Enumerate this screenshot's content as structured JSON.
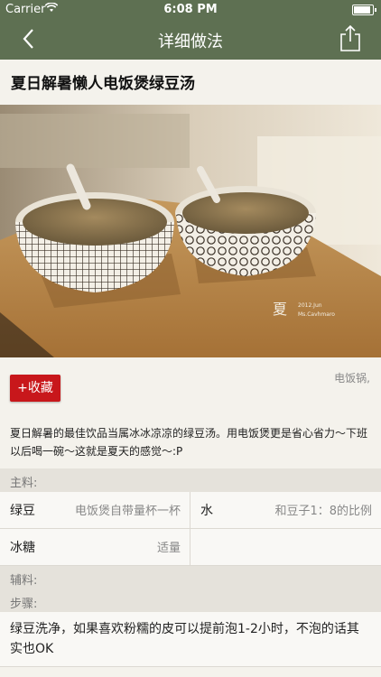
{
  "status_bar": {
    "carrier": "Carrier",
    "time": "6:08 PM",
    "battery_level": 0.9
  },
  "nav": {
    "title": "详细做法",
    "back_icon": "chevron-left-icon",
    "share_icon": "share-icon"
  },
  "recipe": {
    "title": "夏日解暑懒人电饭煲绿豆汤",
    "photo_caption": "夏",
    "photo_text_1": "2012.Jun",
    "photo_text_2": "Ms.Cavhmaro",
    "favorite_label": "+收藏",
    "tools": "电饭锅,",
    "description": "夏日解暑的最佳饮品当属冰冰凉凉的绿豆汤。用电饭煲更是省心省力～下班以后喝一碗～这就是夏天的感觉～:P"
  },
  "ingredients": {
    "main_label": "主料:",
    "rows": [
      {
        "left_name": "绿豆",
        "left_amount": "电饭煲自带量杯一杯",
        "right_name": "水",
        "right_amount": "和豆子1：8的比例"
      },
      {
        "left_name": "冰糖",
        "left_amount": "适量",
        "right_name": "",
        "right_amount": ""
      }
    ],
    "aux_label": "辅料:"
  },
  "steps": {
    "label": "步骤:",
    "items": [
      "绿豆洗净，如果喜欢粉糯的皮可以提前泡1-2小时，不泡的话其实也OK"
    ]
  },
  "colors": {
    "nav_bar": "#5e7052",
    "favorite_button": "#c8171b",
    "background": "#f4f2ec"
  }
}
